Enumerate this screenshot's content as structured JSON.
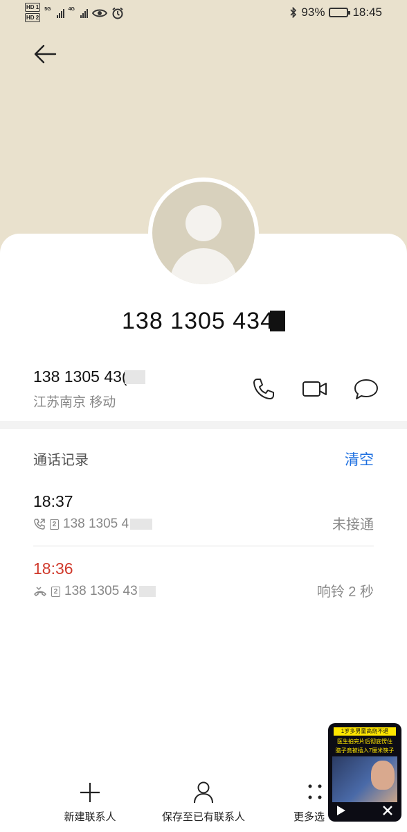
{
  "status_bar": {
    "sim_labels": [
      "HD 1",
      "HD 2"
    ],
    "network_labels": [
      "5G",
      "4G"
    ],
    "battery": "93%",
    "battery_level": 0.93,
    "time": "18:45"
  },
  "header": {
    "back_icon": "arrow-left-icon",
    "title_number": "138 1305 434"
  },
  "contact": {
    "number": "138 1305 43(",
    "location": "江苏南京 移动",
    "actions": [
      "phone-icon",
      "video-call-icon",
      "message-icon"
    ]
  },
  "call_log": {
    "title": "通话记录",
    "clear_label": "清空",
    "entries": [
      {
        "time": "18:37",
        "number": "138 1305 4",
        "status": "未接通",
        "missed": false
      },
      {
        "time": "18:36",
        "number": "138 1305 43",
        "status": "响铃 2 秒",
        "missed": true
      }
    ]
  },
  "bottom_bar": {
    "new_contact": "新建联系人",
    "save_existing": "保存至已有联系人",
    "more": "更多选"
  },
  "floating_video": {
    "caption_1": "1岁多男童高烧不退",
    "caption_2": "医生拍完片后彻底愣住",
    "caption_3": "脑子竟被插入7厘米筷子"
  },
  "colors": {
    "header_bg": "#e9e1cd",
    "accent": "#1d6fe0",
    "missed": "#d0392b"
  }
}
